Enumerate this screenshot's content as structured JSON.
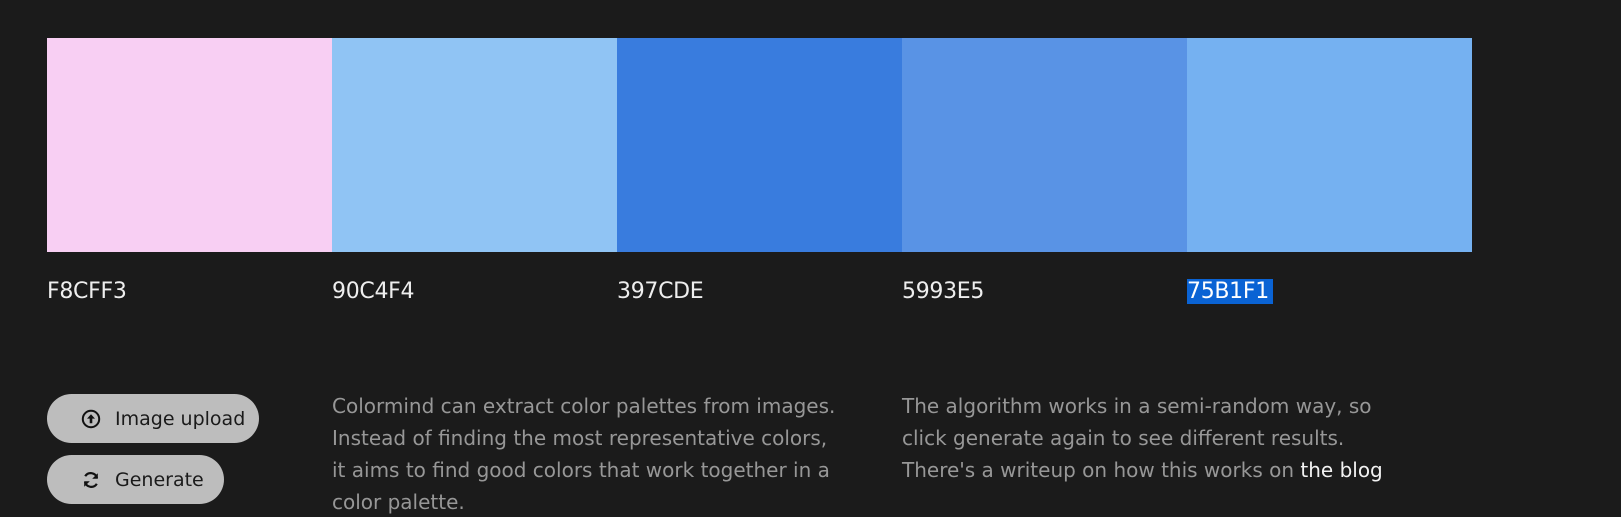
{
  "palette": [
    {
      "hex": "F8CFF3",
      "color": "#F8CFF3",
      "selected": false
    },
    {
      "hex": "90C4F4",
      "color": "#90C4F4",
      "selected": false
    },
    {
      "hex": "397CDE",
      "color": "#397CDE",
      "selected": false
    },
    {
      "hex": "5993E5",
      "color": "#5993E5",
      "selected": false
    },
    {
      "hex": "75B1F1",
      "color": "#75B1F1",
      "selected": true
    }
  ],
  "buttons": {
    "upload_label": "Image upload",
    "upload_icon": "upload-circle-icon",
    "generate_label": "Generate",
    "generate_icon": "refresh-icon"
  },
  "description": {
    "left": "Colormind can extract color palettes from images. Instead of finding the most representative colors, it aims to find good colors that work together in a color palette.",
    "right_text": "The algorithm works in a semi-random way, so click generate again to see different results. There's a writeup on how this works on ",
    "right_link": "the blog"
  },
  "colors": {
    "background": "#1b1b1b",
    "button_bg": "#bdbdbd",
    "selection": "#0a63d4",
    "muted_text": "#979797"
  }
}
